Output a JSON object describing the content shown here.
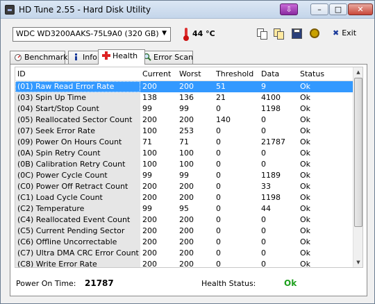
{
  "window": {
    "title": "HD Tune 2.55 - Hard Disk Utility"
  },
  "toolbar": {
    "drive": "WDC WD3200AAKS-75L9A0 (320 GB)",
    "temperature": "44 °C",
    "exit_label": "Exit"
  },
  "tabs": [
    {
      "label": "Benchmark"
    },
    {
      "label": "Info"
    },
    {
      "label": "Health"
    },
    {
      "label": "Error Scan"
    }
  ],
  "table": {
    "headers": {
      "id": "ID",
      "current": "Current",
      "worst": "Worst",
      "threshold": "Threshold",
      "data": "Data",
      "status": "Status"
    },
    "rows": [
      {
        "id": "(01) Raw Read Error Rate",
        "current": "200",
        "worst": "200",
        "threshold": "51",
        "data": "9",
        "status": "Ok"
      },
      {
        "id": "(03) Spin Up Time",
        "current": "138",
        "worst": "136",
        "threshold": "21",
        "data": "4100",
        "status": "Ok"
      },
      {
        "id": "(04) Start/Stop Count",
        "current": "99",
        "worst": "99",
        "threshold": "0",
        "data": "1198",
        "status": "Ok"
      },
      {
        "id": "(05) Reallocated Sector Count",
        "current": "200",
        "worst": "200",
        "threshold": "140",
        "data": "0",
        "status": "Ok"
      },
      {
        "id": "(07) Seek Error Rate",
        "current": "100",
        "worst": "253",
        "threshold": "0",
        "data": "0",
        "status": "Ok"
      },
      {
        "id": "(09) Power On Hours Count",
        "current": "71",
        "worst": "71",
        "threshold": "0",
        "data": "21787",
        "status": "Ok"
      },
      {
        "id": "(0A) Spin Retry Count",
        "current": "100",
        "worst": "100",
        "threshold": "0",
        "data": "0",
        "status": "Ok"
      },
      {
        "id": "(0B) Calibration Retry Count",
        "current": "100",
        "worst": "100",
        "threshold": "0",
        "data": "0",
        "status": "Ok"
      },
      {
        "id": "(0C) Power Cycle Count",
        "current": "99",
        "worst": "99",
        "threshold": "0",
        "data": "1189",
        "status": "Ok"
      },
      {
        "id": "(C0) Power Off Retract Count",
        "current": "200",
        "worst": "200",
        "threshold": "0",
        "data": "33",
        "status": "Ok"
      },
      {
        "id": "(C1) Load Cycle Count",
        "current": "200",
        "worst": "200",
        "threshold": "0",
        "data": "1198",
        "status": "Ok"
      },
      {
        "id": "(C2) Temperature",
        "current": "99",
        "worst": "95",
        "threshold": "0",
        "data": "44",
        "status": "Ok"
      },
      {
        "id": "(C4) Reallocated Event Count",
        "current": "200",
        "worst": "200",
        "threshold": "0",
        "data": "0",
        "status": "Ok"
      },
      {
        "id": "(C5) Current Pending Sector",
        "current": "200",
        "worst": "200",
        "threshold": "0",
        "data": "0",
        "status": "Ok"
      },
      {
        "id": "(C6) Offline Uncorrectable",
        "current": "200",
        "worst": "200",
        "threshold": "0",
        "data": "0",
        "status": "Ok"
      },
      {
        "id": "(C7) Ultra DMA CRC Error Count",
        "current": "200",
        "worst": "200",
        "threshold": "0",
        "data": "0",
        "status": "Ok"
      },
      {
        "id": "(C8) Write Error Rate",
        "current": "200",
        "worst": "200",
        "threshold": "0",
        "data": "0",
        "status": "Ok"
      }
    ]
  },
  "footer": {
    "power_on_label": "Power On Time:",
    "power_on_value": "21787",
    "health_label": "Health Status:",
    "health_value": "Ok"
  }
}
